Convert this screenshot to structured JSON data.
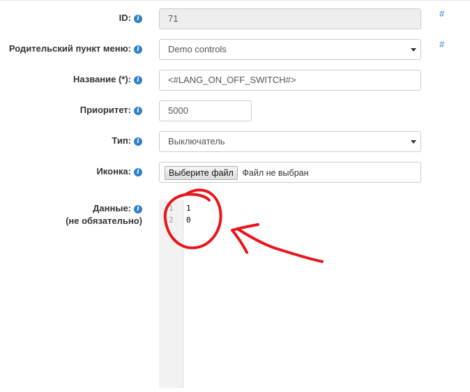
{
  "form": {
    "id": {
      "label": "ID:",
      "value": "71",
      "hash": "#"
    },
    "parent": {
      "label": "Родительский пункт меню:",
      "value": "Demo controls",
      "hash": "#"
    },
    "name": {
      "label": "Название (*):",
      "value": "<#LANG_ON_OFF_SWITCH#>"
    },
    "priority": {
      "label": "Приоритет:",
      "value": "5000"
    },
    "type": {
      "label": "Тип:",
      "value": "Выключатель"
    },
    "icon": {
      "label": "Иконка:",
      "button": "Выберите файл",
      "status": "Файл не выбран"
    },
    "data": {
      "label_line1": "Данные:",
      "label_line2": "(не обязательно)",
      "lines": [
        {
          "num": "1",
          "text": "1"
        },
        {
          "num": "2",
          "text": "0"
        }
      ]
    },
    "info_glyph": "i"
  },
  "annotation": {
    "color": "#e8161d"
  },
  "colors": {
    "accent": "#2f80c6",
    "disabled_bg": "#eeeeee"
  }
}
